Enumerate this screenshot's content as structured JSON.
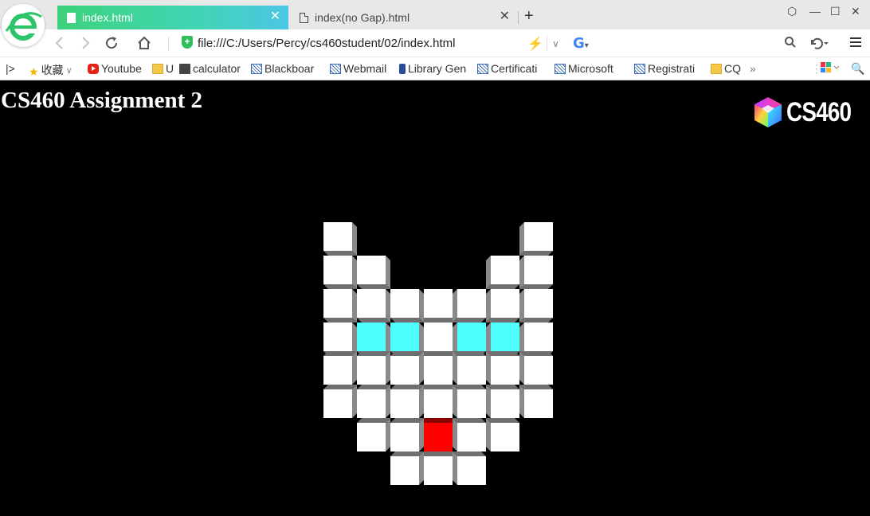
{
  "tabs": [
    {
      "title": "index.html",
      "active": true
    },
    {
      "title": "index(no Gap).html",
      "active": false
    }
  ],
  "toolbar": {
    "url": "file:///C:/Users/Percy/cs460student/02/index.html"
  },
  "bookmarks": [
    {
      "label": "收藏",
      "icon": "star-icon"
    },
    {
      "label": "Youtube",
      "icon": "youtube-icon"
    },
    {
      "label": "U",
      "icon": "folder-icon"
    },
    {
      "label": "calculator",
      "icon": "calculator-icon"
    },
    {
      "label": "Blackboar",
      "icon": "blackboard-icon"
    },
    {
      "label": "Webmail",
      "icon": "blackboard-icon"
    },
    {
      "label": "Library Gen",
      "icon": "library-icon"
    },
    {
      "label": "Certificati",
      "icon": "blackboard-icon"
    },
    {
      "label": "Microsoft",
      "icon": "blackboard-icon"
    },
    {
      "label": "Registrati",
      "icon": "blackboard-icon"
    },
    {
      "label": "CQ",
      "icon": "folder-icon"
    }
  ],
  "page": {
    "title": "CS460 Assignment 2",
    "logo_text": "CS460"
  },
  "cube_grid": {
    "colors": {
      "W": "#ffffff",
      "C": "#4dfffd",
      "R": "#ff0000"
    },
    "rows": [
      "W.....W",
      "WW...WW",
      "WWWWWWW",
      "WCCWCCW",
      "WWWWWWW",
      "WWWWWWW",
      ".WWRWW.",
      "..WWW.."
    ]
  }
}
